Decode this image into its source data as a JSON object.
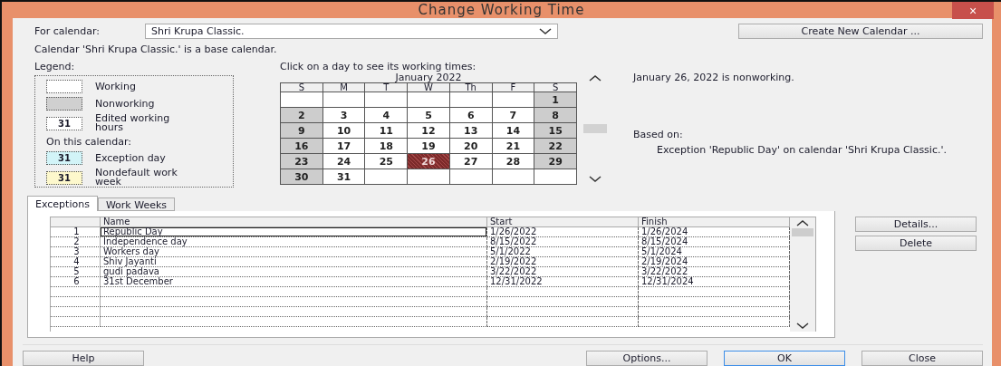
{
  "window": {
    "title": "Change Working Time",
    "close": "×"
  },
  "calendar_select": {
    "label": "For calendar:",
    "value": "Shri Krupa Classic."
  },
  "create_button": "Create New Calendar ...",
  "base_note": "Calendar 'Shri Krupa Classic.' is a base calendar.",
  "legend": {
    "title": "Legend:",
    "items": [
      {
        "kind": "working",
        "label": "Working"
      },
      {
        "kind": "nonworking",
        "label": "Nonworking"
      },
      {
        "kind": "edited",
        "swatch": "31",
        "label": "Edited working hours"
      }
    ],
    "subheading": "On this calendar:",
    "calendar_items": [
      {
        "kind": "exception",
        "swatch": "31",
        "label": "Exception day"
      },
      {
        "kind": "nondefault",
        "swatch": "31",
        "label": "Nondefault work week"
      }
    ]
  },
  "calendar": {
    "hint": "Click on a day to see its working times:",
    "month": "January 2022",
    "weekdays": [
      "S",
      "M",
      "T",
      "W",
      "Th",
      "F",
      "S"
    ],
    "weeks": [
      [
        {
          "kind": "blank"
        },
        {
          "kind": "blank"
        },
        {
          "kind": "blank"
        },
        {
          "kind": "blank"
        },
        {
          "kind": "blank"
        },
        {
          "kind": "blank"
        },
        {
          "kind": "day",
          "day": "1",
          "nonworking": true,
          "selected": false
        }
      ],
      [
        {
          "kind": "day",
          "day": "2",
          "nonworking": true,
          "selected": false
        },
        {
          "kind": "day",
          "day": "3",
          "nonworking": false,
          "selected": false
        },
        {
          "kind": "day",
          "day": "4",
          "nonworking": false,
          "selected": false
        },
        {
          "kind": "day",
          "day": "5",
          "nonworking": false,
          "selected": false
        },
        {
          "kind": "day",
          "day": "6",
          "nonworking": false,
          "selected": false
        },
        {
          "kind": "day",
          "day": "7",
          "nonworking": false,
          "selected": false
        },
        {
          "kind": "day",
          "day": "8",
          "nonworking": true,
          "selected": false
        }
      ],
      [
        {
          "kind": "day",
          "day": "9",
          "nonworking": true,
          "selected": false
        },
        {
          "kind": "day",
          "day": "10",
          "nonworking": false,
          "selected": false
        },
        {
          "kind": "day",
          "day": "11",
          "nonworking": false,
          "selected": false
        },
        {
          "kind": "day",
          "day": "12",
          "nonworking": false,
          "selected": false
        },
        {
          "kind": "day",
          "day": "13",
          "nonworking": false,
          "selected": false
        },
        {
          "kind": "day",
          "day": "14",
          "nonworking": false,
          "selected": false
        },
        {
          "kind": "day",
          "day": "15",
          "nonworking": true,
          "selected": false
        }
      ],
      [
        {
          "kind": "day",
          "day": "16",
          "nonworking": true,
          "selected": false
        },
        {
          "kind": "day",
          "day": "17",
          "nonworking": false,
          "selected": false
        },
        {
          "kind": "day",
          "day": "18",
          "nonworking": false,
          "selected": false
        },
        {
          "kind": "day",
          "day": "19",
          "nonworking": false,
          "selected": false
        },
        {
          "kind": "day",
          "day": "20",
          "nonworking": false,
          "selected": false
        },
        {
          "kind": "day",
          "day": "21",
          "nonworking": false,
          "selected": false
        },
        {
          "kind": "day",
          "day": "22",
          "nonworking": true,
          "selected": false
        }
      ],
      [
        {
          "kind": "day",
          "day": "23",
          "nonworking": true,
          "selected": false
        },
        {
          "kind": "day",
          "day": "24",
          "nonworking": false,
          "selected": false
        },
        {
          "kind": "day",
          "day": "25",
          "nonworking": false,
          "selected": false
        },
        {
          "kind": "day",
          "day": "26",
          "nonworking": true,
          "selected": true
        },
        {
          "kind": "day",
          "day": "27",
          "nonworking": false,
          "selected": false
        },
        {
          "kind": "day",
          "day": "28",
          "nonworking": false,
          "selected": false
        },
        {
          "kind": "day",
          "day": "29",
          "nonworking": true,
          "selected": false
        }
      ],
      [
        {
          "kind": "day",
          "day": "30",
          "nonworking": true,
          "selected": false
        },
        {
          "kind": "day",
          "day": "31",
          "nonworking": false,
          "selected": false
        },
        {
          "kind": "blank"
        },
        {
          "kind": "blank"
        },
        {
          "kind": "blank"
        },
        {
          "kind": "blank"
        },
        {
          "kind": "blank"
        }
      ]
    ]
  },
  "info": {
    "status": "January 26, 2022 is nonworking.",
    "based_on_label": "Based on:",
    "based_on": "Exception 'Republic Day' on calendar 'Shri Krupa Classic.'."
  },
  "tabs": [
    {
      "label": "Exceptions",
      "selected": true
    },
    {
      "label": "Work Weeks",
      "selected": false
    }
  ],
  "table": {
    "columns": [
      "Name",
      "Start",
      "Finish"
    ],
    "rows": [
      {
        "number": "1",
        "name": "Republic Day",
        "start": "1/26/2022",
        "finish": "1/26/2024",
        "selected": true
      },
      {
        "number": "2",
        "name": "Independence day",
        "start": "8/15/2022",
        "finish": "8/15/2024",
        "selected": false
      },
      {
        "number": "3",
        "name": "Workers day",
        "start": "5/1/2022",
        "finish": "5/1/2024",
        "selected": false
      },
      {
        "number": "4",
        "name": "Shiv Jayanti",
        "start": "2/19/2022",
        "finish": "2/19/2024",
        "selected": false
      },
      {
        "number": "5",
        "name": "gudi padava",
        "start": "3/22/2022",
        "finish": "3/22/2022",
        "selected": false
      },
      {
        "number": "6",
        "name": "31st December",
        "start": "12/31/2022",
        "finish": "12/31/2024",
        "selected": false
      }
    ]
  },
  "side_buttons": [
    "Details...",
    "Delete"
  ],
  "footer_buttons": [
    {
      "label": "Help",
      "default": false
    },
    {
      "label": "Options...",
      "default": false
    },
    {
      "label": "OK",
      "default": true
    },
    {
      "label": "Close",
      "default": false
    }
  ]
}
